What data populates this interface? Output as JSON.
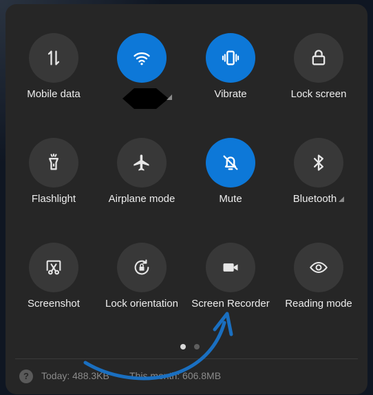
{
  "tiles": [
    {
      "label": "Mobile data",
      "icon": "mobile-data-icon",
      "active": false
    },
    {
      "label": "",
      "icon": "wifi-icon",
      "active": true
    },
    {
      "label": "Vibrate",
      "icon": "vibrate-icon",
      "active": true
    },
    {
      "label": "Lock screen",
      "icon": "lock-icon",
      "active": false
    },
    {
      "label": "Flashlight",
      "icon": "flashlight-icon",
      "active": false
    },
    {
      "label": "Airplane mode",
      "icon": "airplane-icon",
      "active": false
    },
    {
      "label": "Mute",
      "icon": "bell-off-icon",
      "active": true
    },
    {
      "label": "Bluetooth",
      "icon": "bluetooth-icon",
      "active": false
    },
    {
      "label": "Screenshot",
      "icon": "screenshot-icon",
      "active": false
    },
    {
      "label": "Lock orientation",
      "icon": "rotation-lock-icon",
      "active": false
    },
    {
      "label": "Screen Recorder",
      "icon": "video-camera-icon",
      "active": false
    },
    {
      "label": "Reading mode",
      "icon": "eye-icon",
      "active": false
    }
  ],
  "pager": {
    "total": 2,
    "current": 1
  },
  "footer": {
    "help_glyph": "?",
    "today": "Today: 488.3KB",
    "month": "This month: 606.8MB"
  },
  "colors": {
    "panel": "#262626",
    "tile_inactive": "#383838",
    "accent": "#0d78d8",
    "annotation_arrow": "#1a6fc0"
  }
}
